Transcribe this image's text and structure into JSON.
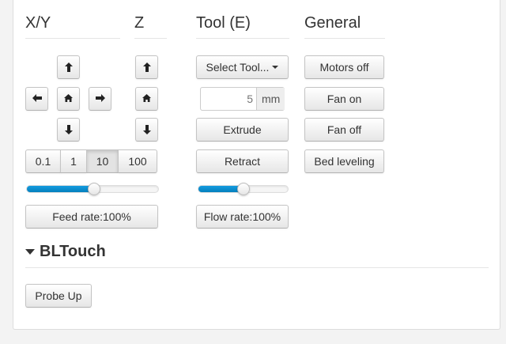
{
  "columns": {
    "xy": {
      "title": "X/Y"
    },
    "z": {
      "title": "Z"
    },
    "tool": {
      "title": "Tool (E)"
    },
    "general": {
      "title": "General"
    }
  },
  "xy": {
    "step_options": [
      "0.1",
      "1",
      "10",
      "100"
    ],
    "selected_step": "10",
    "feed_rate_label": "Feed rate:100%",
    "feed_rate_slider_fraction": 0.51
  },
  "tool": {
    "select_label": "Select Tool...",
    "extrude_amount_placeholder": "5",
    "extrude_amount_unit": "mm",
    "extrude_label": "Extrude",
    "retract_label": "Retract",
    "flow_rate_label": "Flow rate:100%",
    "flow_rate_slider_fraction": 0.5
  },
  "general": {
    "motors_off_label": "Motors off",
    "fan_on_label": "Fan on",
    "fan_off_label": "Fan off",
    "bed_leveling_label": "Bed leveling"
  },
  "bltouch": {
    "title": "BLTouch",
    "probe_up_label": "Probe Up"
  },
  "icons": {
    "up": "arrow-up-icon",
    "down": "arrow-down-icon",
    "left": "arrow-left-icon",
    "right": "arrow-right-icon",
    "home": "home-icon"
  },
  "colors": {
    "slider_fill": "#0480be",
    "button_border": "#c4c4c4"
  }
}
